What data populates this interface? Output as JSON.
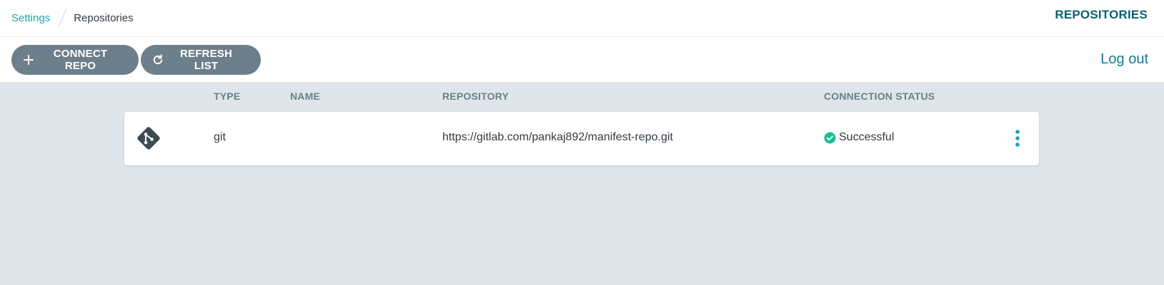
{
  "breadcrumb": {
    "parent": "Settings",
    "current": "Repositories"
  },
  "page_title": "REPOSITORIES",
  "toolbar": {
    "connect_label": "CONNECT REPO",
    "refresh_label": "REFRESH LIST",
    "logout_label": "Log out"
  },
  "table": {
    "headers": {
      "type": "TYPE",
      "name": "NAME",
      "repository": "REPOSITORY",
      "status": "CONNECTION STATUS"
    },
    "rows": [
      {
        "icon": "git-logo-icon",
        "type": "git",
        "name": "",
        "repository": "https://gitlab.com/pankaj892/manifest-repo.git",
        "status": "Successful"
      }
    ]
  },
  "colors": {
    "accent": "#1fa3ad",
    "title": "#0c5f70",
    "button": "#6d7f8b",
    "background": "#dee6eb",
    "success": "#18be94"
  }
}
